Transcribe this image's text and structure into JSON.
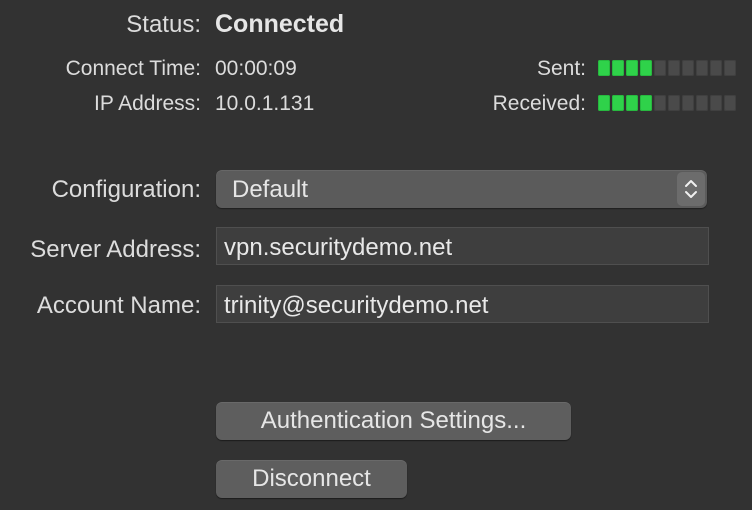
{
  "status": {
    "label": "Status:",
    "value": "Connected"
  },
  "connect_time": {
    "label": "Connect Time:",
    "value": "00:00:09"
  },
  "ip_address": {
    "label": "IP Address:",
    "value": "10.0.1.131"
  },
  "sent": {
    "label": "Sent:",
    "level": 4,
    "max": 10,
    "color": "#2fd24a"
  },
  "received": {
    "label": "Received:",
    "level": 4,
    "max": 10,
    "color": "#2fd24a"
  },
  "configuration": {
    "label": "Configuration:",
    "selected": "Default",
    "icon": "up-down-chevron-icon"
  },
  "server_address": {
    "label": "Server Address:",
    "value": "vpn.securitydemo.net"
  },
  "account_name": {
    "label": "Account Name:",
    "value": "trinity@securitydemo.net"
  },
  "buttons": {
    "authentication": "Authentication Settings...",
    "disconnect": "Disconnect"
  }
}
